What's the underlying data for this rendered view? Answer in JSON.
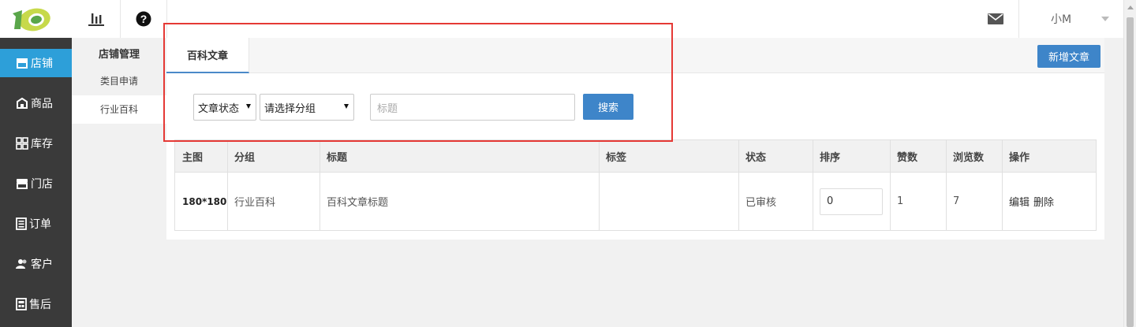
{
  "topbar": {
    "user_name": "小M",
    "icons": [
      "bar-chart-icon",
      "help-icon",
      "mail-icon"
    ]
  },
  "sidebar": {
    "items": [
      {
        "label": "店铺",
        "icon": "store-icon",
        "active": true
      },
      {
        "label": "商品",
        "icon": "goods-icon"
      },
      {
        "label": "库存",
        "icon": "grid-icon"
      },
      {
        "label": "门店",
        "icon": "shop-icon"
      },
      {
        "label": "订单",
        "icon": "order-icon"
      },
      {
        "label": "客户",
        "icon": "customer-icon"
      },
      {
        "label": "售后",
        "icon": "after-sale-icon"
      }
    ]
  },
  "subnav": {
    "title": "店铺管理",
    "items": [
      {
        "label": "类目申请"
      },
      {
        "label": "行业百科",
        "active": true
      }
    ]
  },
  "main": {
    "tab_label": "百科文章",
    "add_button": "新增文章",
    "filters": {
      "status_select": "文章状态",
      "group_select": "请选择分组",
      "title_placeholder": "标题",
      "search_button": "搜索"
    },
    "table": {
      "columns": [
        "主图",
        "分组",
        "标题",
        "标签",
        "状态",
        "排序",
        "赞数",
        "浏览数",
        "操作"
      ],
      "rows": [
        {
          "image": "180*180",
          "group": "行业百科",
          "title": "百科文章标题",
          "tags": "",
          "status": "已审核",
          "sort": "0",
          "likes": "1",
          "views": "7",
          "edit": "编辑",
          "delete": "删除"
        }
      ]
    }
  },
  "colors": {
    "accent_blue": "#3e85c9",
    "sidebar_active": "#2d9fd9",
    "sidebar_bg": "#3a3a3a",
    "highlight_red": "#e53935"
  }
}
